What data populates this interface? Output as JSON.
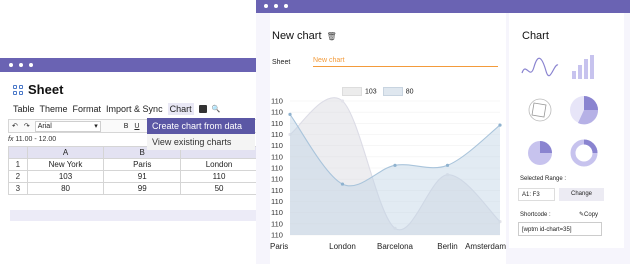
{
  "sheet": {
    "title": "Sheet",
    "menu": [
      "Table",
      "Theme",
      "Format",
      "Import & Sync",
      "Chart"
    ],
    "toolbar": {
      "undo": "↶",
      "redo": "↷",
      "font": "Arial",
      "bold": "B",
      "underline": "U"
    },
    "formula": "11.00 - 12.00",
    "columns": [
      "",
      "A",
      "B",
      ""
    ],
    "rows": [
      [
        "1",
        "New York",
        "Paris",
        "London"
      ],
      [
        "2",
        "103",
        "91",
        "110"
      ],
      [
        "3",
        "80",
        "99",
        "50"
      ]
    ],
    "dropdown": [
      "Create chart from data",
      "View existing charts"
    ]
  },
  "chart_panel": {
    "title": "New chart",
    "sheet_label": "Sheet",
    "sheet_value": "New chart",
    "side_title": "Chart",
    "selected_range_label": "Selected Range :",
    "range_value": "A1: F3",
    "change_label": "Change",
    "shortcode_label": "Shortcode :",
    "copy_label": "Copy",
    "shortcode_value": "[wptm id-chart=35]"
  },
  "chart_data": {
    "type": "area",
    "categories": [
      "Paris",
      "London",
      "Barcelona",
      "Berlin",
      "Amsterdam"
    ],
    "y_tick_labels": [
      "110",
      "110",
      "110",
      "110",
      "110",
      "110",
      "110",
      "110",
      "110",
      "110",
      "110",
      "110",
      "110"
    ],
    "series": [
      {
        "name": "103",
        "values": [
          0.75,
          1.0,
          0.05,
          0.45,
          0.1
        ],
        "color": "#d9d9e3"
      },
      {
        "name": "80",
        "values": [
          0.9,
          0.38,
          0.52,
          0.52,
          0.82
        ],
        "color": "#b9cde0"
      }
    ]
  },
  "colors": {
    "accent": "#6a63b3",
    "highlight": "#5b57a5",
    "orange": "#f39b3b"
  }
}
